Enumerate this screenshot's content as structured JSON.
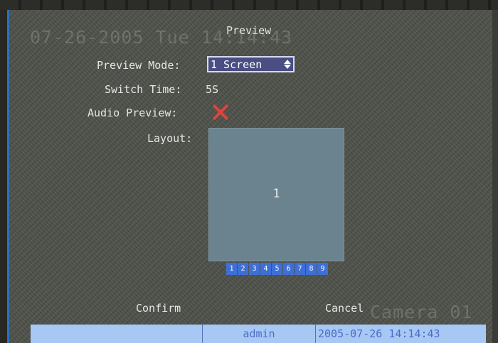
{
  "overlay": {
    "datetime_watermark": "07-26-2005 Tue 14:14:43",
    "camera_watermark": "Camera 01"
  },
  "dialog": {
    "title": "Preview",
    "fields": {
      "preview_mode_label": "Preview Mode:",
      "preview_mode_value": "1 Screen",
      "switch_time_label": "Switch Time:",
      "switch_time_value": "5S",
      "audio_preview_label": "Audio Preview:",
      "audio_preview_enabled": false,
      "layout_label": "Layout:"
    },
    "layout": {
      "window_number": "1",
      "channels": [
        "1",
        "2",
        "3",
        "4",
        "5",
        "6",
        "7",
        "8",
        "9"
      ]
    },
    "buttons": {
      "confirm": "Confirm",
      "cancel": "Cancel"
    }
  },
  "statusbar": {
    "blank": "",
    "user": "admin",
    "datetime": "2005-07-26 14:14:43"
  },
  "colors": {
    "background": "#4d4f49",
    "selected_field": "#4a4e82",
    "layout_window": "#6b838f",
    "channel_button": "#3e6fd6",
    "disabled_mark": "#e0443c",
    "statusbar": "#a8c8f4"
  },
  "icons": {
    "audio_preview": "x-mark-icon",
    "preview_mode_spinner": "up-down-arrows-icon"
  }
}
